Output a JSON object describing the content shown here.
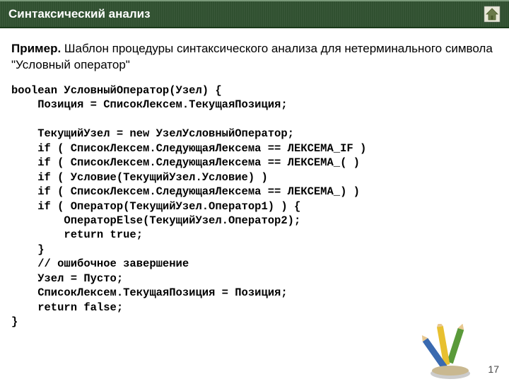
{
  "header": {
    "title": "Синтаксический анализ"
  },
  "example": {
    "prefix": "Пример.",
    "text": " Шаблон процедуры синтаксического анализа для нетерминального символа \"Условный оператор\""
  },
  "code": {
    "l1": "boolean УсловныйОператор(Узел) {",
    "l2": "    Позиция = СписокЛексем.ТекущаяПозиция;",
    "l3": "",
    "l4": "    ТекущийУзел = new УзелУсловныйОператор;",
    "l5": "    if ( СписокЛексем.СледующаяЛексема == ЛЕКСЕМА_IF )",
    "l6": "    if ( СписокЛексем.СледующаяЛексема == ЛЕКСЕМА_( )",
    "l7": "    if ( Условие(ТекущийУзел.Условие) )",
    "l8": "    if ( СписокЛексем.СледующаяЛексема == ЛЕКСЕМА_) )",
    "l9": "    if ( Оператор(ТекущийУзел.Оператор1) ) {",
    "l10": "        ОператорElse(ТекущийУзел.Оператор2);",
    "l11": "        return true;",
    "l12": "    }",
    "l13": "    // ошибочное завершение",
    "l14": "    Узел = Пусто;",
    "l15": "    СписокЛексем.ТекущаяПозиция = Позиция;",
    "l16": "    return false;",
    "l17": "}"
  },
  "page_number": "17"
}
